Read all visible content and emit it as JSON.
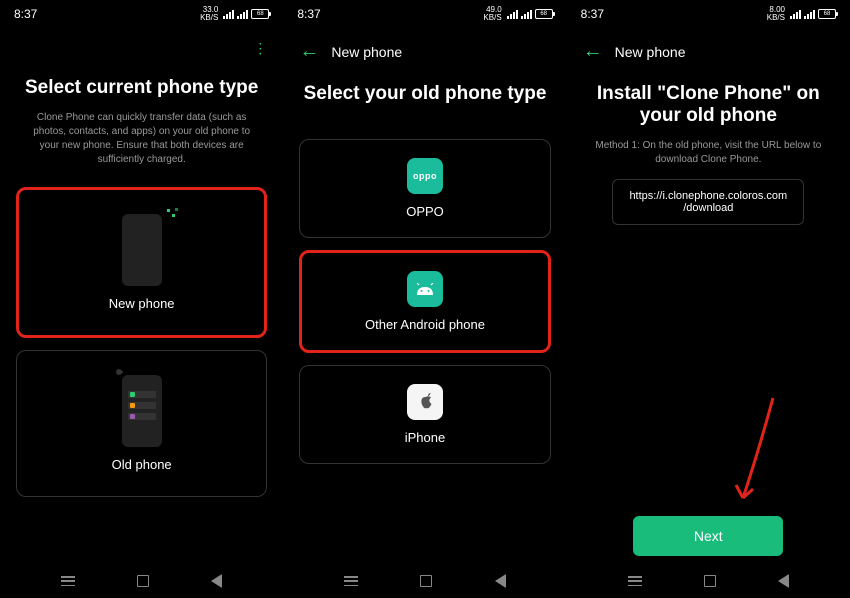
{
  "status": {
    "time": "8:37",
    "net_speeds": [
      "33.0",
      "49.0",
      "8.00"
    ],
    "net_unit": "KB/S"
  },
  "screen1": {
    "title": "Select current phone type",
    "subtitle": "Clone Phone can quickly transfer data (such as photos, contacts, and apps) on your old phone to your new phone. Ensure that both devices are sufficiently charged.",
    "card_new": "New phone",
    "card_old": "Old phone"
  },
  "screen2": {
    "topbar_title": "New phone",
    "title": "Select your old phone type",
    "card_oppo": "OPPO",
    "card_android": "Other Android phone",
    "card_iphone": "iPhone",
    "oppo_label": "oppo"
  },
  "screen3": {
    "topbar_title": "New phone",
    "title": "Install \"Clone Phone\" on your old phone",
    "subtitle": "Method 1: On the old phone, visit the URL below to download Clone Phone.",
    "url_line1": "https://i.clonephone.coloros.com",
    "url_line2": "/download",
    "next_label": "Next"
  }
}
